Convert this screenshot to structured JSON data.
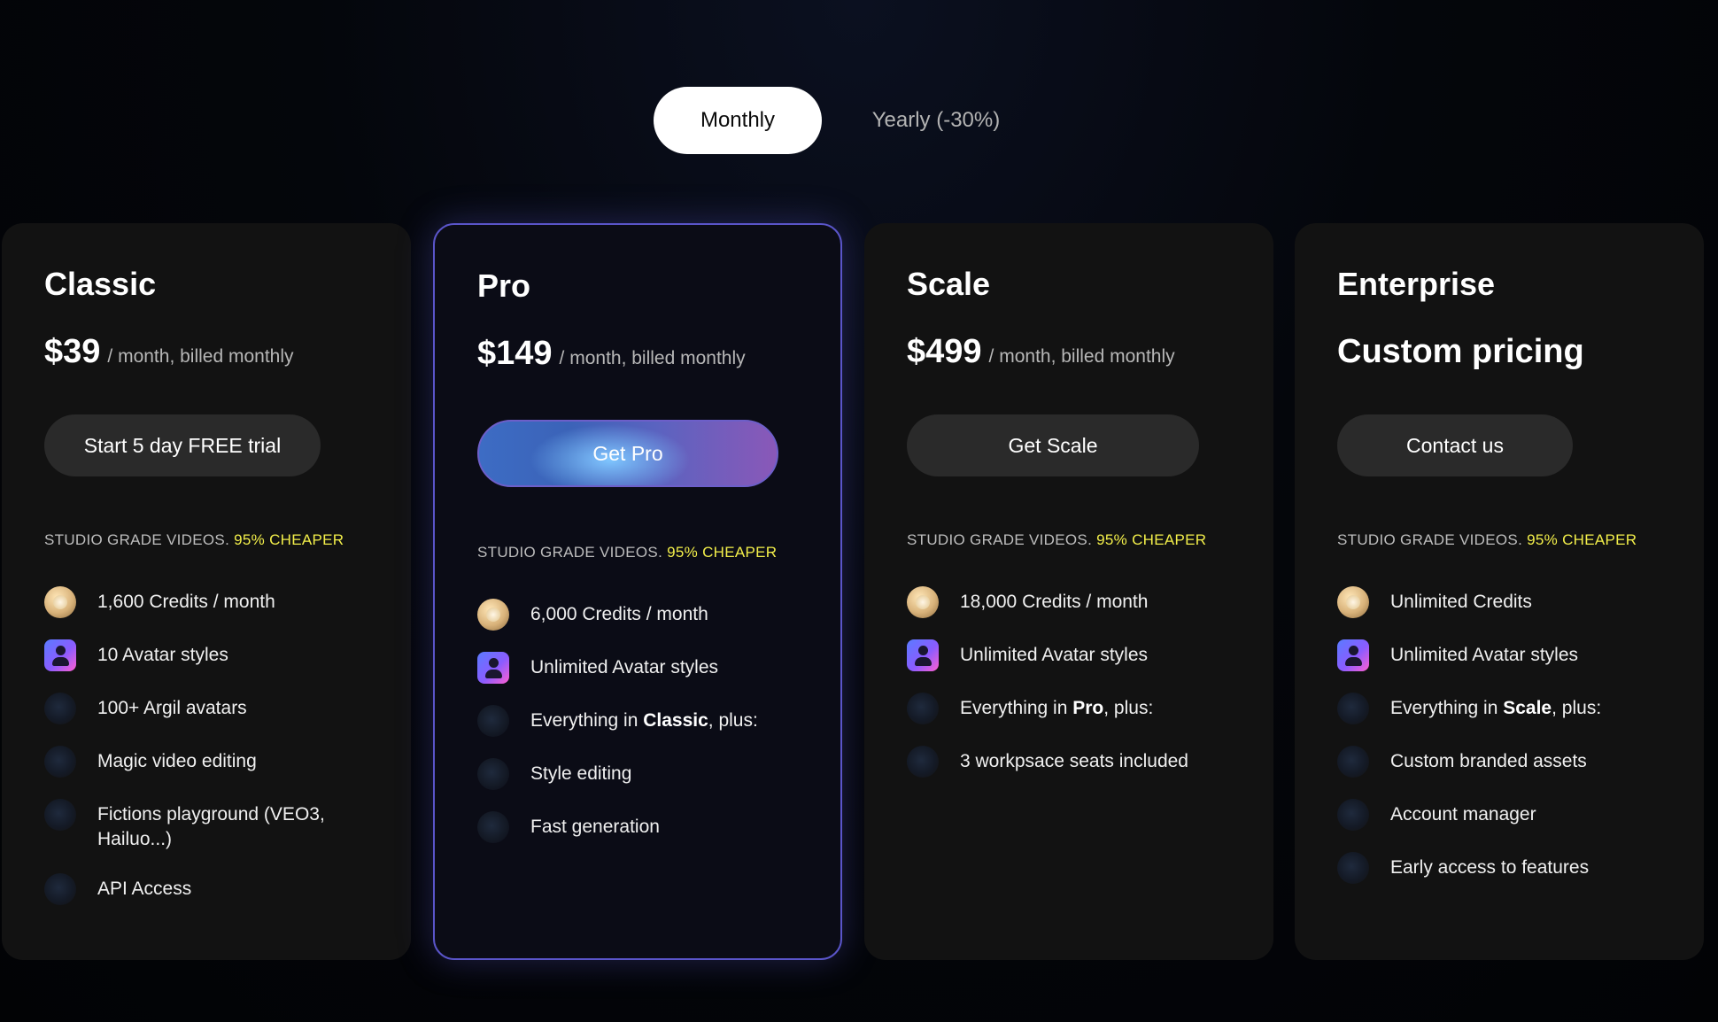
{
  "toggle": {
    "monthly_label": "Monthly",
    "yearly_label": "Yearly (-30%)",
    "selected": "Monthly"
  },
  "tagline": {
    "prefix": "STUDIO GRADE VIDEOS.",
    "highlight": "95% CHEAPER",
    "highlight_color": "#f3ef4a"
  },
  "plans": [
    {
      "name": "Classic",
      "price": "$39",
      "period": "/ month, billed monthly",
      "cta": "Start 5 day FREE trial",
      "features": [
        {
          "icon": "coin-icon",
          "text": "1,600 Credits / month"
        },
        {
          "icon": "avatar-icon",
          "text": "10 Avatar styles"
        },
        {
          "icon": "dot-icon",
          "text": "100+ Argil avatars"
        },
        {
          "icon": "dot-icon",
          "text": "Magic video editing"
        },
        {
          "icon": "dot-icon",
          "text": "Fictions playground (VEO3, Hailuo...)"
        },
        {
          "icon": "dot-icon",
          "text": "API Access"
        }
      ]
    },
    {
      "name": "Pro",
      "price": "$149",
      "period": "/ month, billed monthly",
      "cta": "Get Pro",
      "border_color": "#5a55c9",
      "features": [
        {
          "icon": "coin-icon",
          "text": "6,000 Credits / month"
        },
        {
          "icon": "avatar-icon",
          "text": "Unlimited Avatar styles"
        },
        {
          "icon": "dot-icon",
          "text_before": "Everything in ",
          "text_bold": "Classic",
          "text_after": ", plus:"
        },
        {
          "icon": "dot-icon",
          "text": "Style editing"
        },
        {
          "icon": "dot-icon",
          "text": "Fast generation"
        }
      ]
    },
    {
      "name": "Scale",
      "price": "$499",
      "period": "/ month, billed monthly",
      "cta": "Get Scale",
      "features": [
        {
          "icon": "coin-icon",
          "text": "18,000 Credits / month"
        },
        {
          "icon": "avatar-icon",
          "text": "Unlimited Avatar styles"
        },
        {
          "icon": "dot-icon",
          "text_before": "Everything in ",
          "text_bold": "Pro",
          "text_after": ", plus:"
        },
        {
          "icon": "dot-icon",
          "text": "3 workpsace seats included"
        }
      ]
    },
    {
      "name": "Enterprise",
      "price": "Custom pricing",
      "cta": "Contact us",
      "features": [
        {
          "icon": "coin-icon",
          "text": "Unlimited Credits"
        },
        {
          "icon": "avatar-icon",
          "text": "Unlimited Avatar styles"
        },
        {
          "icon": "dot-icon",
          "text_before": "Everything in ",
          "text_bold": "Scale",
          "text_after": ", plus:"
        },
        {
          "icon": "dot-icon",
          "text": "Custom branded assets"
        },
        {
          "icon": "dot-icon",
          "text": "Account manager"
        },
        {
          "icon": "dot-icon",
          "text": "Early access to features"
        }
      ]
    }
  ]
}
